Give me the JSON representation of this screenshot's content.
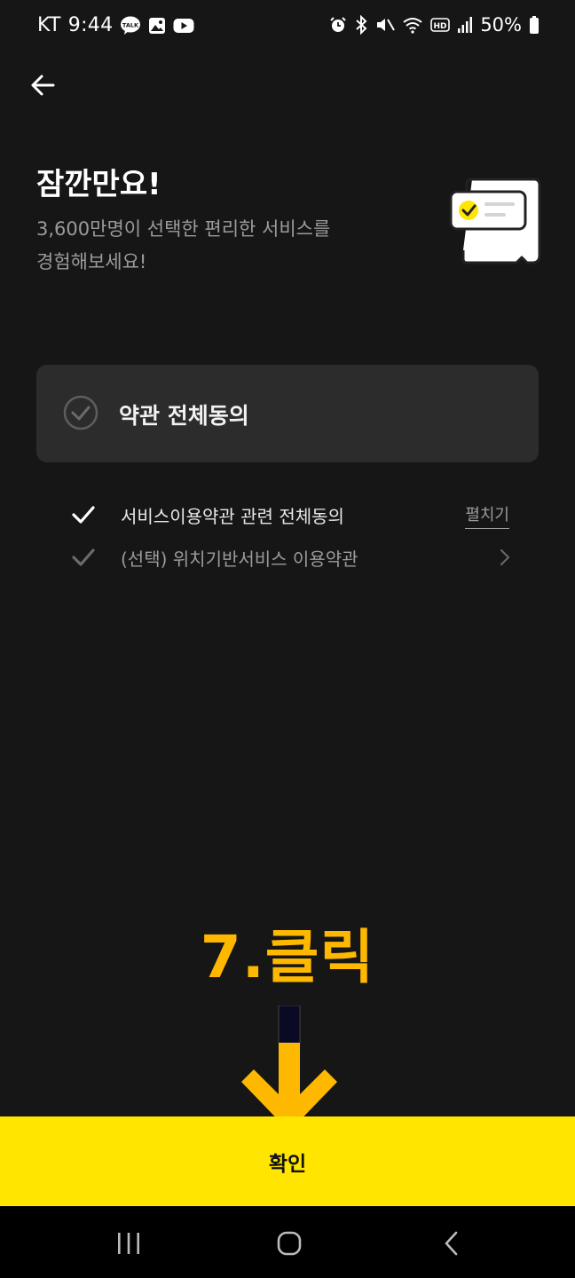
{
  "status_bar": {
    "carrier": "KT",
    "time": "9:44",
    "battery": "50%",
    "left_icons": [
      "kakaotalk-icon",
      "gallery-icon",
      "youtube-icon"
    ],
    "right_icons": [
      "alarm-icon",
      "bluetooth-icon",
      "mute-icon",
      "wifi-icon",
      "hd-icon",
      "signal-icon",
      "battery-icon"
    ]
  },
  "header": {
    "back_icon": "arrow-left-icon"
  },
  "main": {
    "title": "잠깐만요!",
    "subtitle_line1": "3,600만명이 선택한 편리한 서비스를",
    "subtitle_line2": "경험해보세요!",
    "illustration": "document-check-icon",
    "agree_all": {
      "label": "약관 전체동의",
      "checked": false
    },
    "terms": [
      {
        "label": "서비스이용약관 관련 전체동의",
        "action": "펼치기",
        "checked": true
      },
      {
        "label": "(선택) 위치기반서비스 이용약관",
        "action_icon": "chevron-right-icon",
        "checked": false
      }
    ]
  },
  "annotation": {
    "text": "7.클릭",
    "color": "#ffb800"
  },
  "footer": {
    "confirm_label": "확인",
    "color": "#ffe500"
  },
  "nav_bar": {
    "buttons": [
      "recent-apps-icon",
      "home-icon",
      "back-icon"
    ]
  }
}
